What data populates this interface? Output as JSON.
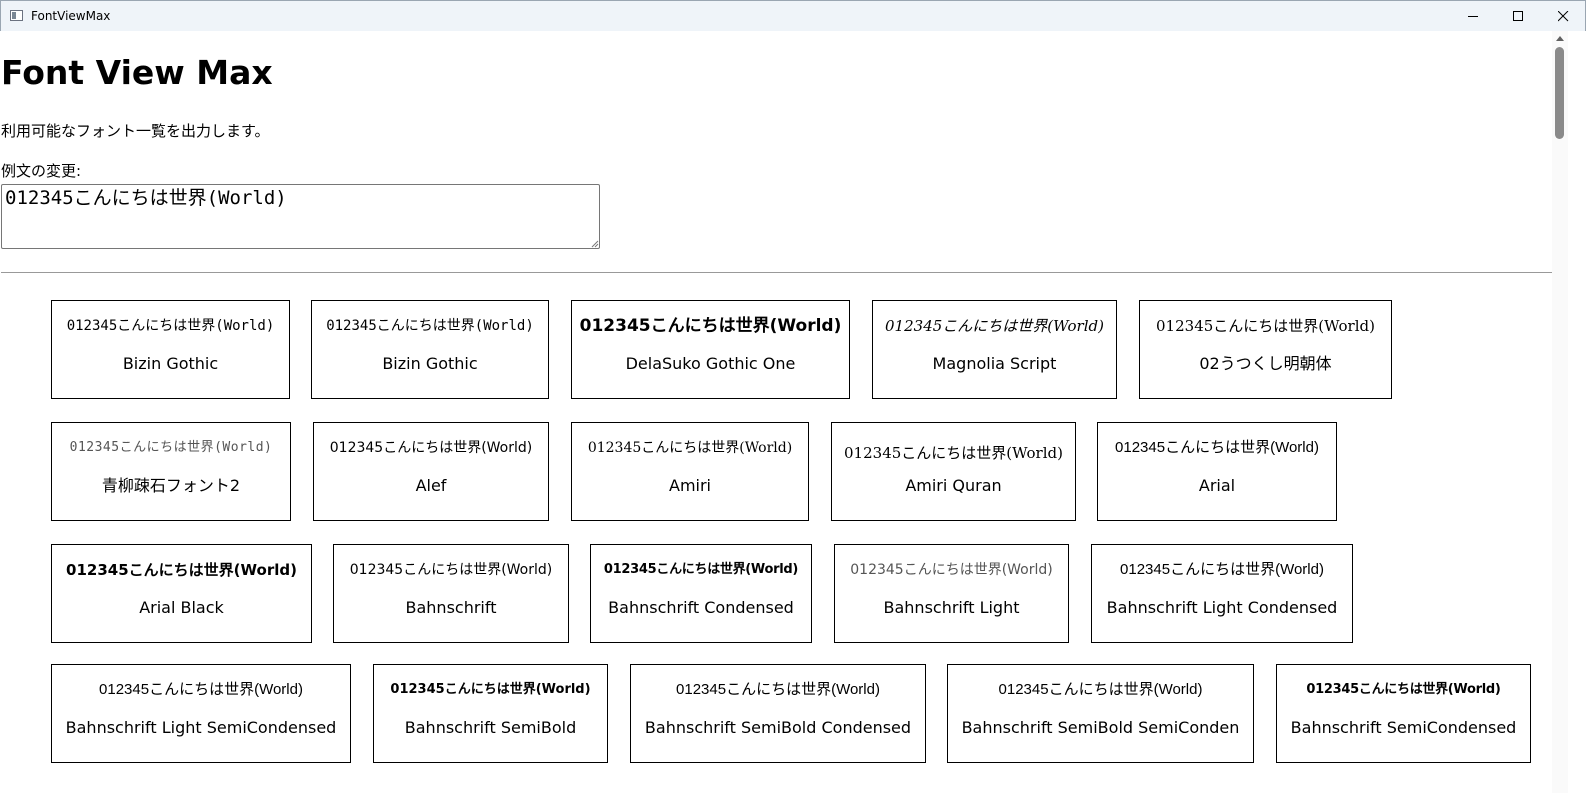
{
  "window": {
    "title": "FontViewMax"
  },
  "header": {
    "title": "Font View Max",
    "description": "利用可能なフォント一覧を出力します。",
    "sample_label": "例文の変更:",
    "sample_text": "012345こんにちは世界(World)"
  },
  "fonts": [
    {
      "sample": "012345こんにちは世界(World)",
      "name": "Bizin Gothic"
    },
    {
      "sample": "012345こんにちは世界(World)",
      "name": "Bizin Gothic"
    },
    {
      "sample": "012345こんにちは世界(World)",
      "name": "DelaSuko Gothic One"
    },
    {
      "sample": "012345こんにちは世界(World)",
      "name": "Magnolia Script"
    },
    {
      "sample": "012345こんにちは世界(World)",
      "name": "02うつくし明朝体"
    },
    {
      "sample": "012345こんにちは世界(World)",
      "name": "青柳疎石フォント2"
    },
    {
      "sample": "012345こんにちは世界(World)",
      "name": "Alef"
    },
    {
      "sample": "012345こんにちは世界(World)",
      "name": "Amiri"
    },
    {
      "sample": "012345こんにちは世界(World)",
      "name": "Amiri Quran"
    },
    {
      "sample": "012345こんにちは世界(World)",
      "name": "Arial"
    },
    {
      "sample": "012345こんにちは世界(World)",
      "name": "Arial Black"
    },
    {
      "sample": "012345こんにちは世界(World)",
      "name": "Bahnschrift"
    },
    {
      "sample": "012345こんにちは世界(World)",
      "name": "Bahnschrift Condensed"
    },
    {
      "sample": "012345こんにちは世界(World)",
      "name": "Bahnschrift Light"
    },
    {
      "sample": "012345こんにちは世界(World)",
      "name": "Bahnschrift Light Condensed"
    },
    {
      "sample": "012345こんにちは世界(World)",
      "name": "Bahnschrift Light SemiCondensed"
    },
    {
      "sample": "012345こんにちは世界(World)",
      "name": "Bahnschrift SemiBold"
    },
    {
      "sample": "012345こんにちは世界(World)",
      "name": "Bahnschrift SemiBold Condensed"
    },
    {
      "sample": "012345こんにちは世界(World)",
      "name": "Bahnschrift SemiBold SemiConden"
    },
    {
      "sample": "012345こんにちは世界(World)",
      "name": "Bahnschrift SemiCondensed"
    }
  ]
}
